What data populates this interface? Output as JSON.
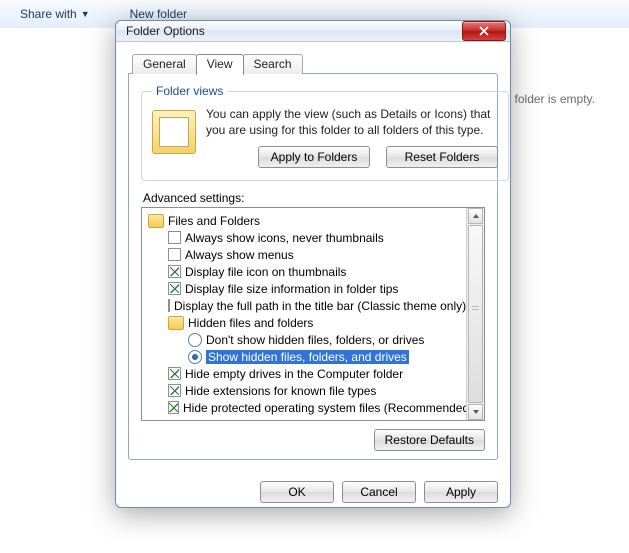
{
  "background": {
    "share_with": "Share with",
    "new_folder": "New folder",
    "empty_suffix": "s folder is empty."
  },
  "dialog": {
    "title": "Folder Options",
    "close_glyph": "X",
    "tabs": {
      "general": "General",
      "view": "View",
      "search": "Search"
    },
    "folder_views": {
      "legend": "Folder views",
      "desc": "You can apply the view (such as Details or Icons) that you are using for this folder to all folders of this type.",
      "apply": "Apply to Folders",
      "reset": "Reset Folders"
    },
    "advanced_label": "Advanced settings:",
    "tree": {
      "root": "Files and Folders",
      "r1": "Always show icons, never thumbnails",
      "r2": "Always show menus",
      "r3": "Display file icon on thumbnails",
      "r4": "Display file size information in folder tips",
      "r5": "Display the full path in the title bar (Classic theme only)",
      "group": "Hidden files and folders",
      "opt1": "Don't show hidden files, folders, or drives",
      "opt2": "Show hidden files, folders, and drives",
      "r6": "Hide empty drives in the Computer folder",
      "r7": "Hide extensions for known file types",
      "r8": "Hide protected operating system files (Recommended)"
    },
    "restore": "Restore Defaults",
    "ok": "OK",
    "cancel": "Cancel",
    "apply": "Apply"
  }
}
